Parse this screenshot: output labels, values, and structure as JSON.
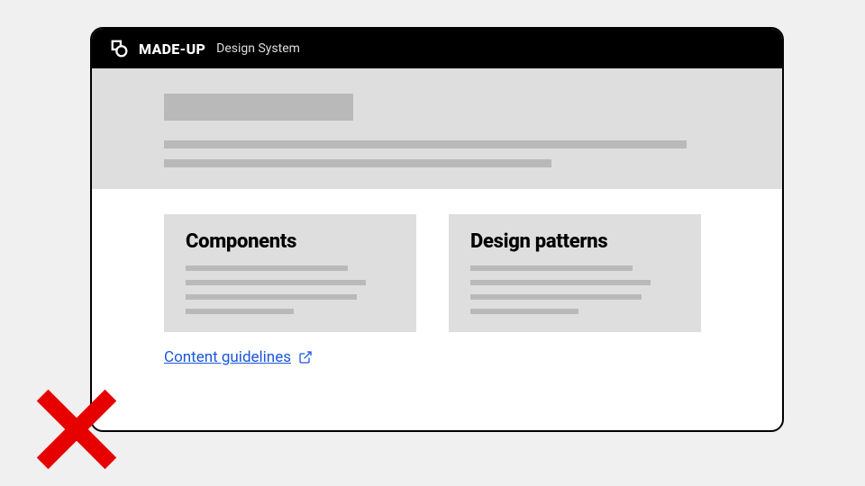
{
  "header": {
    "brand": "MADE-UP",
    "subbrand": "Design System"
  },
  "cards": [
    {
      "title": "Components"
    },
    {
      "title": "Design patterns"
    }
  ],
  "link": {
    "label": "Content guidelines"
  }
}
